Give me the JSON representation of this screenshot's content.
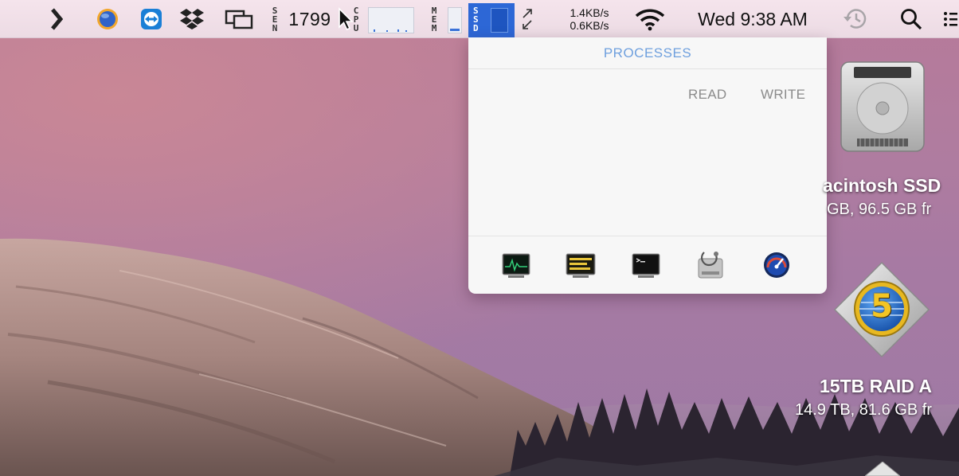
{
  "menubar": {
    "icons": {
      "chevron": "chevron-right-icon",
      "browser": "globe-icon",
      "teamviewer": "teamviewer-icon",
      "dropbox": "dropbox-icon",
      "windows": "overlapping-windows-icon",
      "wifi": "wifi-icon",
      "time_machine": "time-machine-icon",
      "spotlight": "search-icon",
      "notification": "notification-list-icon"
    },
    "sensor": {
      "letters": [
        "S",
        "E",
        "N"
      ],
      "value": "1799"
    },
    "cpu": {
      "letters": [
        "C",
        "P",
        "U"
      ]
    },
    "mem": {
      "letters": [
        "M",
        "E",
        "M"
      ]
    },
    "disk": {
      "letters": [
        "S",
        "S",
        "D"
      ]
    },
    "network": {
      "up": "1.4KB/s",
      "down": "0.6KB/s"
    },
    "clock": "Wed 9:38 AM"
  },
  "popover": {
    "title": "PROCESSES",
    "columns": [
      "READ",
      "WRITE"
    ],
    "footer_apps": [
      {
        "name": "activity-monitor-icon"
      },
      {
        "name": "console-icon"
      },
      {
        "name": "terminal-icon"
      },
      {
        "name": "disk-utility-icon"
      },
      {
        "name": "istat-menus-icon"
      }
    ]
  },
  "desktop": {
    "drives": [
      {
        "name": "acintosh SSD",
        "info": "GB, 96.5 GB fr"
      },
      {
        "name": "15TB RAID A",
        "info": "14.9 TB, 81.6 GB fr",
        "badge": "5"
      }
    ]
  },
  "colors": {
    "menubar": "#f0dfe8",
    "accent_blue": "#2d67d6",
    "popover_title": "#6fa0de"
  }
}
